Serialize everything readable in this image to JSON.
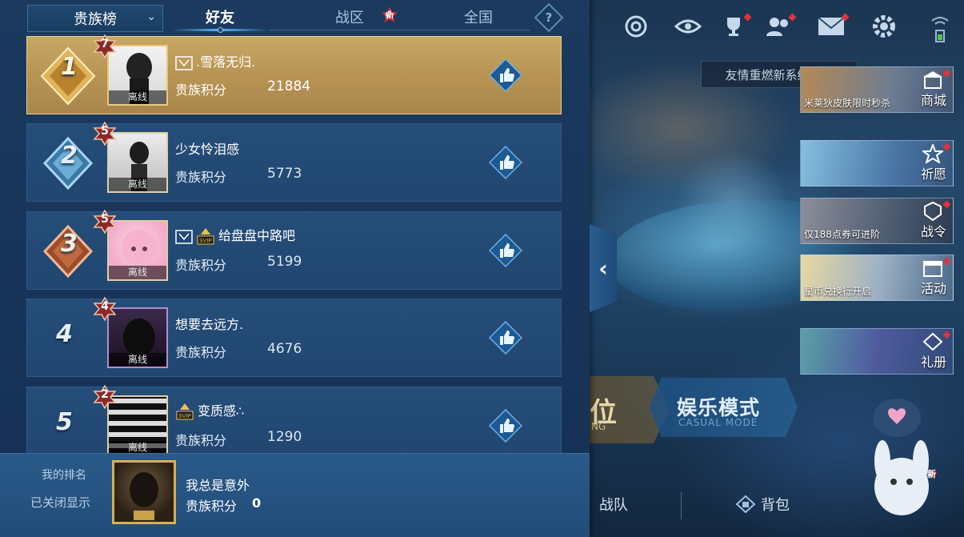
{
  "header": {
    "dropdown_label": "贵族榜",
    "tabs": [
      {
        "label": "好友",
        "active": true
      },
      {
        "label": "战区",
        "badge": "新"
      },
      {
        "label": "全国"
      }
    ],
    "help_label": "?"
  },
  "rows": [
    {
      "rank": "1",
      "level": "7",
      "name": ".雪落无归.",
      "score_label": "贵族积分",
      "score": "21884",
      "status": "离线",
      "has_noble_icon": true,
      "has_svip": false
    },
    {
      "rank": "2",
      "level": "5",
      "name": "少女怜泪感",
      "score_label": "贵族积分",
      "score": "5773",
      "status": "离线",
      "has_noble_icon": false,
      "has_svip": false
    },
    {
      "rank": "3",
      "level": "5",
      "name": "给盘盘中路吧",
      "score_label": "贵族积分",
      "score": "5199",
      "status": "离线",
      "has_noble_icon": true,
      "has_svip": true
    },
    {
      "rank": "4",
      "level": "4",
      "name": "想要去远方.",
      "score_label": "贵族积分",
      "score": "4676",
      "status": "离线",
      "has_noble_icon": false,
      "has_svip": false
    },
    {
      "rank": "5",
      "level": "2",
      "name": "变质感∴",
      "score_label": "贵族积分",
      "score": "1290",
      "status": "离线",
      "has_noble_icon": false,
      "has_svip": true
    }
  ],
  "footer": {
    "my_rank_label": "我的排名",
    "closed_label": "已关闭显示",
    "my_name": "我总是意外",
    "score_label": "贵族积分",
    "score": "0"
  },
  "right": {
    "notice": "友情重燃新系统上线",
    "tiles": [
      {
        "caption": "米莱狄皮肤限时秒杀",
        "label": "商城"
      },
      {
        "caption": "",
        "label": "祈愿"
      },
      {
        "caption": "仅188点券可进阶",
        "label": "战令"
      },
      {
        "caption": "星币兑换行开启",
        "label": "活动"
      },
      {
        "caption": "",
        "label": "礼册"
      }
    ],
    "mode_ranked": "位",
    "mode_ranked_sub": "NG",
    "mode_casual": "娱乐模式",
    "mode_casual_sub": "CASUAL MODE",
    "bottom_items": [
      "战队",
      "背包"
    ],
    "mascot_badge": "新"
  },
  "colors": {
    "panel_bg": "#1b3a5e",
    "first_row_gold": "#c7a865",
    "row_blue": "#244d78",
    "accent_blue": "#58b6ff",
    "badge_red": "#d82b30"
  }
}
